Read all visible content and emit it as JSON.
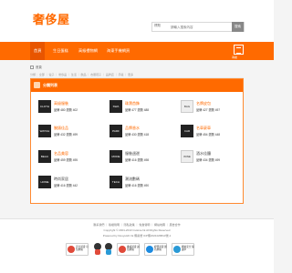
{
  "header": {
    "logo": "奢侈屋",
    "search": {
      "select": "標題",
      "placeholder": "請輸入搜索內容",
      "button": "搜索"
    }
  },
  "nav": {
    "items": [
      {
        "label": "首頁",
        "active": true
      },
      {
        "label": "生日蛋糕"
      },
      {
        "label": "高級禮物網"
      },
      {
        "label": "海東手機網頁"
      }
    ],
    "icon_label": "導航"
  },
  "breadcrumb": {
    "path": "首頁"
  },
  "tags": "分類 ：全部 ｜ 電子 ｜ 奢侈品 ｜ 生活 ｜ 飲品 ｜ 衣服鞋子 ｜ 品牌店 ｜ 手錶 ｜ 更多",
  "panel": {
    "title": "分類列表",
    "items": [
      {
        "name": "高級服裝",
        "meta": "品牌 480 瀏覽 402",
        "thumb": "CLOTH",
        "color": "orange"
      },
      {
        "name": "珠寶首飾",
        "meta": "品牌 477 瀏覽 488",
        "thumb": "SWA",
        "color": "orange"
      },
      {
        "name": "名牌皮包",
        "meta": "品牌 427 瀏覽 497",
        "thumb": "BAG",
        "color": "orange",
        "light": true
      },
      {
        "name": "腕錶佳品",
        "meta": "品牌 432 瀏覽 499",
        "thumb": "WATCH",
        "color": "orange"
      },
      {
        "name": "品牌香水",
        "meta": "品牌 430 瀏覽 418",
        "thumb": "PARF",
        "color": "orange"
      },
      {
        "name": "名車豪車",
        "meta": "品牌 454 瀏覽 448",
        "thumb": "CAR",
        "color": "orange"
      },
      {
        "name": "名品美容",
        "meta": "品牌 459 瀏覽 495",
        "thumb": "BEAU",
        "color": "orange"
      },
      {
        "name": "服裝週邊",
        "meta": "品牌 416 瀏覽 498",
        "thumb": "MODE",
        "color": "gray"
      },
      {
        "name": "酒水佳釀",
        "meta": "品牌 434 瀏覽 499",
        "thumb": "WINE",
        "color": "gray",
        "light": true
      },
      {
        "name": "時尚家居",
        "meta": "品牌 416 瀏覽 442",
        "thumb": "HOME",
        "color": "gray"
      },
      {
        "name": "潮流數碼",
        "meta": "品牌 416 瀏覽 490",
        "thumb": "TECH",
        "color": "gray"
      }
    ]
  },
  "footer": {
    "line1": "聯系我們 ｜ 版權聲明 ｜ 隱私政策 ｜ 免責聲明 ｜ 網站地圖 ｜ 廣告合作",
    "line2": "Copyright © 2001-2013 Cuisine.hk All Rights Reserved",
    "line3": "Powered by DouyuHK.hk 備案號 ICP備2021028813號-1",
    "badges": [
      {
        "label": "安全認證 可信網站",
        "color": "#e04a3a"
      },
      {
        "label": "權威認證 誠信網站",
        "color": "#e04a3a"
      },
      {
        "label": "經營認證 實名網站",
        "color": "#1c8be0"
      },
      {
        "label": "網站安全 保護中",
        "color": "#2a9ad6"
      }
    ]
  }
}
